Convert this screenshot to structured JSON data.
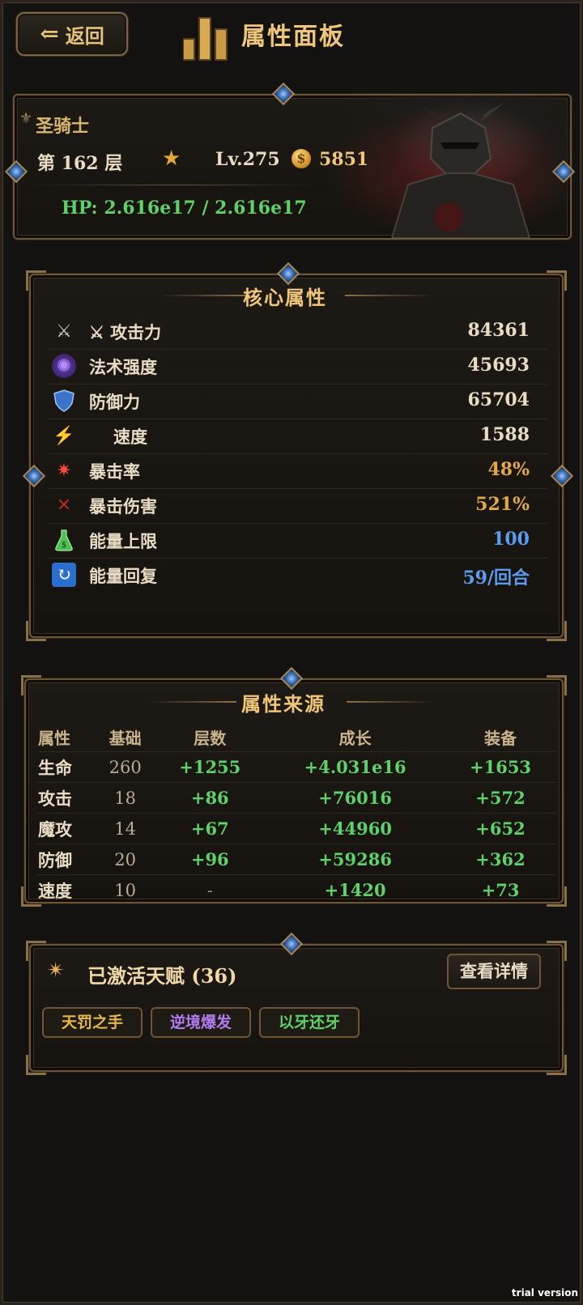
{
  "header": {
    "back_label": "返回",
    "title": "属性面板"
  },
  "hero": {
    "class_name": "圣骑士",
    "floor": "第 162 层",
    "level": "Lv.275",
    "gold": "5851",
    "coin_symbol": "$",
    "hp": "HP: 2.616e17 / 2.616e17"
  },
  "core": {
    "title": "核心属性",
    "stats": [
      {
        "icon": "crossed-swords-icon",
        "label": "⚔ 攻击力",
        "value": "84361"
      },
      {
        "icon": "magic-orb-icon",
        "label": "法术强度",
        "value": "45693"
      },
      {
        "icon": "shield-icon",
        "label": "防御力",
        "value": "65704"
      },
      {
        "icon": "lightning-icon",
        "label": "速度",
        "value": "1588"
      },
      {
        "icon": "spark-icon",
        "label": "暴击率",
        "value": "48%"
      },
      {
        "icon": "crit-swords-icon",
        "label": "暴击伤害",
        "value": "521%"
      },
      {
        "icon": "potion-icon",
        "label": "能量上限",
        "value": "100"
      },
      {
        "icon": "swirl-icon",
        "label": "能量回复",
        "value": "59/回合"
      }
    ]
  },
  "sources": {
    "title": "属性来源",
    "headers": [
      "属性",
      "基础",
      "层数",
      "成长",
      "装备"
    ],
    "rows": [
      [
        "生命",
        "260",
        "+1255",
        "+4.031e16",
        "+1653"
      ],
      [
        "攻击",
        "18",
        "+86",
        "+76016",
        "+572"
      ],
      [
        "魔攻",
        "14",
        "+67",
        "+44960",
        "+652"
      ],
      [
        "防御",
        "20",
        "+96",
        "+59286",
        "+362"
      ],
      [
        "速度",
        "10",
        "-",
        "+1420",
        "+73"
      ]
    ]
  },
  "talents": {
    "title": "已激活天赋 (36)",
    "detail_label": "查看详情",
    "tags": [
      "天罚之手",
      "逆境爆发",
      "以牙还牙"
    ],
    "tag_colors": [
      "#e6b84a",
      "#b07cf0",
      "#5ed169"
    ]
  },
  "watermark": "trial version",
  "colors": {
    "accent": "#f0c67a",
    "hp_green": "#5ed169",
    "blue": "#5b9cf0",
    "orange": "#e0a848"
  }
}
